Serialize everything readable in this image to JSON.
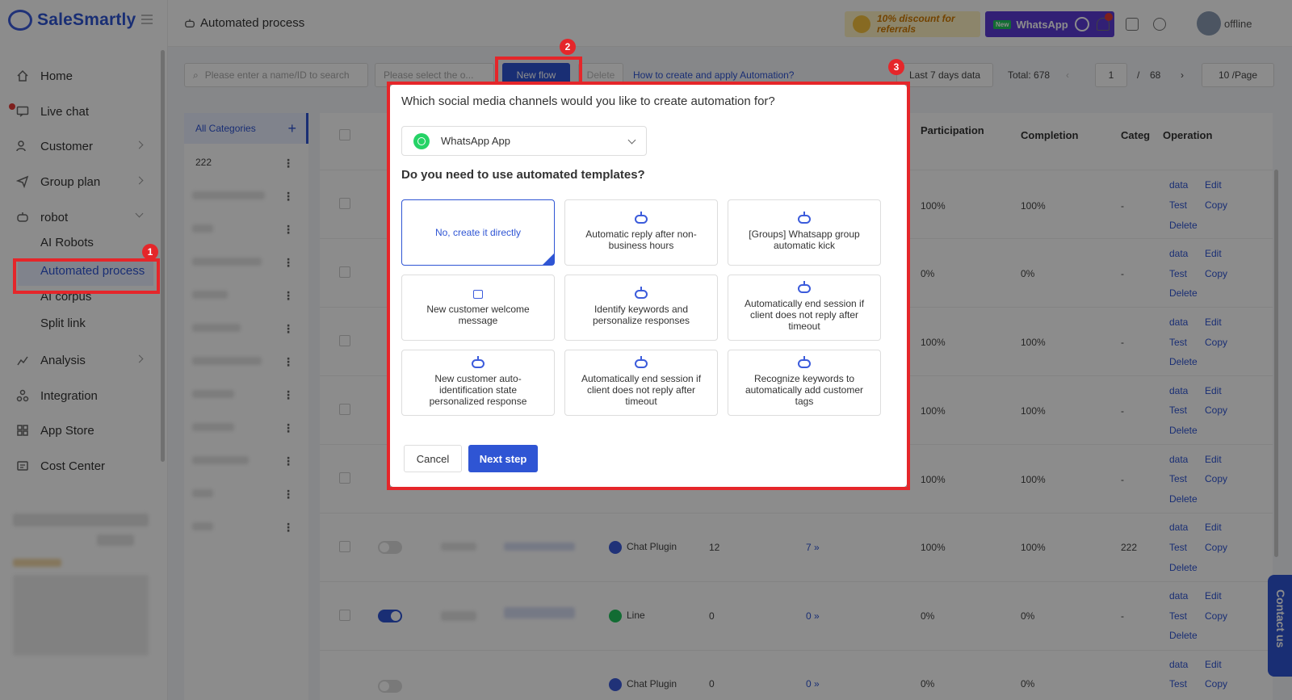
{
  "app": {
    "name": "SaleSmartly",
    "page_title": "Automated process",
    "status": "offline"
  },
  "header": {
    "promo_text": "10% discount for referrals",
    "wa_banner_text": "WhatsApp",
    "wa_new": "New"
  },
  "sidebar": {
    "items": [
      {
        "label": "Home",
        "icon": "home-icon"
      },
      {
        "label": "Live chat",
        "icon": "chat-icon"
      },
      {
        "label": "Customer",
        "icon": "customer-icon"
      },
      {
        "label": "Group plan",
        "icon": "send-icon"
      },
      {
        "label": "robot",
        "icon": "robot-icon"
      },
      {
        "label": "Analysis",
        "icon": "chart-icon"
      },
      {
        "label": "Integration",
        "icon": "integration-icon"
      },
      {
        "label": "App Store",
        "icon": "apps-icon"
      },
      {
        "label": "Cost Center",
        "icon": "wallet-icon"
      }
    ],
    "robot_sub": [
      "AI Robots",
      "Automated process",
      "AI corpus",
      "Split link"
    ]
  },
  "toolbar": {
    "search_placeholder": "Please enter a name/ID to search",
    "select_placeholder": "Please select the o...",
    "new_flow": "New flow",
    "delete": "Delete",
    "help_link": "How to create and apply Automation?",
    "date_range": "Last 7 days data",
    "total_label": "Total:",
    "total": "678",
    "page": "1",
    "page_sep": "/",
    "pages": "68",
    "per_page": "10 /Page"
  },
  "categories": {
    "all": "All Categories",
    "first": "222"
  },
  "table": {
    "headers": {
      "participation": "Participation",
      "completion": "Completion",
      "category": "Categ",
      "operation": "Operation"
    },
    "rows": [
      {
        "participation": "100%",
        "completion": "100%",
        "category": "-"
      },
      {
        "participation": "0%",
        "completion": "0%",
        "category": "-"
      },
      {
        "participation": "100%",
        "completion": "100%",
        "category": "-"
      },
      {
        "participation": "100%",
        "completion": "100%",
        "category": "-"
      },
      {
        "participation": "100%",
        "completion": "100%",
        "category": "-"
      },
      {
        "channel": "Chat Plugin",
        "count": "12",
        "steps": "7 »",
        "participation": "100%",
        "completion": "100%",
        "category": "222"
      },
      {
        "channel": "Line",
        "count": "0",
        "steps": "0 »",
        "participation": "0%",
        "completion": "0%",
        "category": "-"
      },
      {
        "channel": "Chat Plugin",
        "count": "0",
        "steps": "0 »",
        "participation": "0%",
        "completion": "0%",
        "category": ""
      }
    ],
    "ops": {
      "data": "data",
      "edit": "Edit",
      "test": "Test",
      "copy": "Copy",
      "delete": "Delete"
    }
  },
  "contact_us": "Contact us",
  "badges": [
    "1",
    "2",
    "3"
  ],
  "modal": {
    "question_channel": "Which social media channels would you like to create automation for?",
    "channel_selected": "WhatsApp App",
    "question_templates": "Do you need to use automated templates?",
    "templates": [
      {
        "label": "No, create it directly",
        "selected": true
      },
      {
        "label": "Automatic reply after non-business hours"
      },
      {
        "label": "[Groups] Whatsapp group automatic kick"
      },
      {
        "label": "New customer welcome message"
      },
      {
        "label": "Identify keywords and personalize responses"
      },
      {
        "label": "Automatically end session if client does not reply after timeout"
      },
      {
        "label": "New customer auto-identification state personalized response"
      },
      {
        "label": "Automatically end session if client does not reply after timeout"
      },
      {
        "label": "Recognize keywords to automatically add customer tags"
      }
    ],
    "cancel": "Cancel",
    "next": "Next step"
  },
  "colors": {
    "brand": "#2f55d4",
    "annotation": "#e5262a",
    "whatsapp": "#25d366"
  }
}
